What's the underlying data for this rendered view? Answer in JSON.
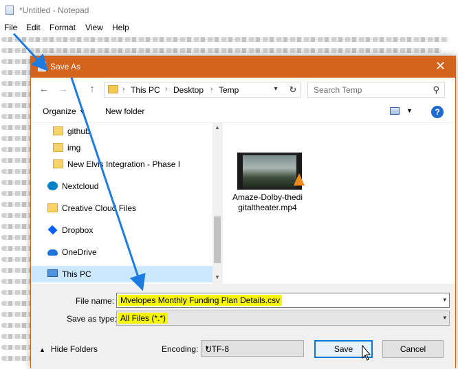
{
  "notepad": {
    "title": "*Untitled - Notepad",
    "menu": [
      "File",
      "Edit",
      "Format",
      "View",
      "Help"
    ]
  },
  "dialog": {
    "title": "Save As",
    "close_glyph": "✕",
    "nav": {
      "back_glyph": "←",
      "forward_glyph": "→",
      "up_glyph": "↑",
      "breadcrumb": [
        "This PC",
        "Desktop",
        "Temp"
      ],
      "search_placeholder": "Search Temp"
    },
    "toolbar": {
      "organize": "Organize",
      "new_folder": "New folder",
      "help_glyph": "?"
    },
    "nav_items": [
      {
        "label": "github",
        "icon": "folder-icon"
      },
      {
        "label": "img",
        "icon": "folder-icon"
      },
      {
        "label": "New Elvis Integration - Phase I",
        "icon": "folder-synced-icon"
      },
      {
        "label": "Nextcloud",
        "icon": "nextcloud-icon"
      },
      {
        "label": "Creative Cloud Files",
        "icon": "creative-cloud-icon"
      },
      {
        "label": "Dropbox",
        "icon": "dropbox-icon"
      },
      {
        "label": "OneDrive",
        "icon": "onedrive-icon"
      },
      {
        "label": "This PC",
        "icon": "this-pc-icon",
        "selected": true
      }
    ],
    "files": [
      {
        "name": "Amaze-Dolby-thedigitaltheater.mp4",
        "icon": "video-file-icon"
      }
    ],
    "file_name_label": "File name:",
    "file_name_value": "Mvelopes Monthly Funding Plan Details.csv",
    "save_type_label": "Save as type:",
    "save_type_value": "All Files  (*.*)",
    "hide_folders": "Hide Folders",
    "encoding_label": "Encoding:",
    "encoding_value": "UTF-8",
    "save_button": "Save",
    "cancel_button": "Cancel"
  },
  "colors": {
    "title_bar": "#d4631c",
    "highlight": "#f6f600",
    "annotation_arrow": "#1e7be0",
    "selection": "#cce8ff"
  }
}
